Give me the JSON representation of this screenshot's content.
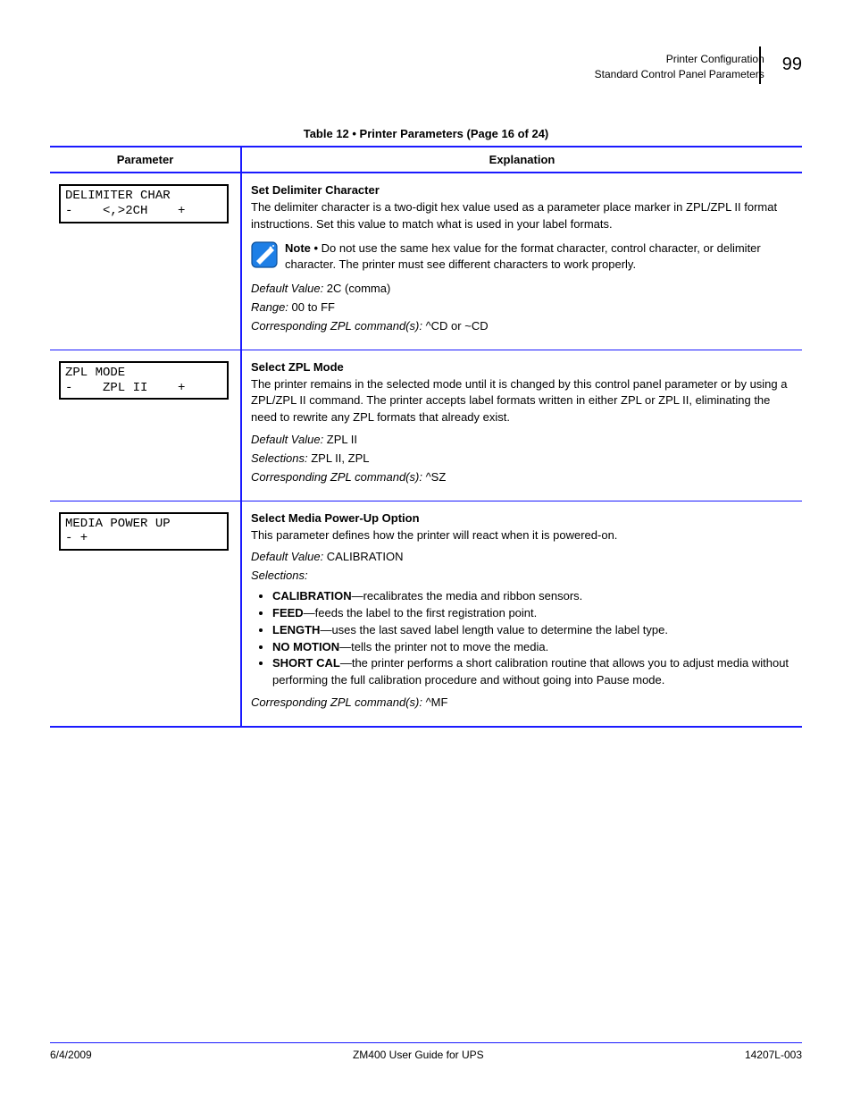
{
  "header": {
    "section": "Printer Configuration",
    "subsection": "Standard Control Panel Parameters",
    "page_number": "99"
  },
  "table": {
    "caption": "Table 12 • Printer Parameters (Page 16 of 24)",
    "col_left": "Parameter",
    "col_right": "Explanation",
    "rows": [
      {
        "lcd_line1": "DELIMITER CHAR",
        "lcd_line2": "-    <,>2CH    +",
        "title": "Set Delimiter Character",
        "body1": "The delimiter character is a two-digit hex value used as a parameter place marker in ZPL/ZPL II format instructions. Set this value to match what is used in your label formats.",
        "note_label": "Note • ",
        "note_body": "Do not use the same hex value for the format character, control character, or delimiter character. The printer must see different characters to work properly.",
        "kv": {
          "default_label": "Default Value: ",
          "default_value": "2C (comma)",
          "range_label": "Range: ",
          "range_value": "00 to FF",
          "zpl_label": "Corresponding ZPL command(s):",
          "zpl_value": " ^CD or ~CD"
        }
      },
      {
        "lcd_line1": "ZPL MODE",
        "lcd_line2": "-    ZPL II    +",
        "title": "Select ZPL Mode",
        "body1": "The printer remains in the selected mode until it is changed by this control panel parameter or by using a ZPL/ZPL II command. The printer accepts label formats written in either ZPL or ZPL II, eliminating the need to rewrite any ZPL formats that already exist.",
        "kv": {
          "default_label": "Default Value: ",
          "default_value": "ZPL II",
          "selections_label": "Selections: ",
          "selections_value": "ZPL II, ZPL",
          "zpl_label": "Corresponding ZPL command(s):",
          "zpl_value": " ^SZ"
        }
      },
      {
        "lcd_line1": "MEDIA POWER UP",
        "lcd_line2": "- +",
        "title": "Select Media Power-Up Option",
        "body1": "This parameter defines how the printer will react when it is powered-on.",
        "kv": {
          "default_label": "Default Value: ",
          "default_value": "CALIBRATION",
          "selections_label": "Selections:",
          "zpl_label": "Corresponding ZPL command(s):",
          "zpl_value": " ^MF"
        },
        "bullets": [
          {
            "name": "CALIBRATION",
            "desc": "—recalibrates the media and ribbon sensors."
          },
          {
            "name": "FEED",
            "desc": "—feeds the label to the first registration point."
          },
          {
            "name": "LENGTH",
            "desc": "—uses the last saved label length value to determine the label type."
          },
          {
            "name": "NO MOTION",
            "desc": "—tells the printer not to move the media."
          },
          {
            "name": "SHORT CAL",
            "desc": "—the printer performs a short calibration routine that allows you to adjust media without performing the full calibration procedure and without going into Pause mode."
          }
        ]
      }
    ]
  },
  "footer": {
    "left": "6/4/2009",
    "center": "ZM400 User Guide for UPS",
    "right": "14207L-003"
  }
}
